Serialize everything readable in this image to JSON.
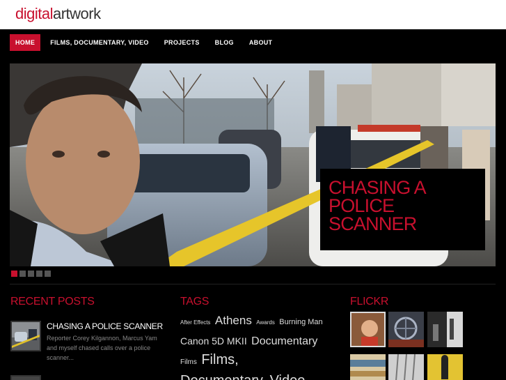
{
  "header": {
    "logo_part1": "digital",
    "logo_part2": "artwork"
  },
  "nav": {
    "items": [
      "HOME",
      "FILMS, DOCUMENTARY, VIDEO",
      "PROJECTS",
      "BLOG",
      "ABOUT"
    ],
    "active": "HOME"
  },
  "slider": {
    "caption_line1": "CHASING A",
    "caption_line2": "POLICE",
    "caption_line3": "SCANNER",
    "slide_count": 5,
    "active_index": 0
  },
  "recent_posts": {
    "title": "RECENT POSTS",
    "posts": [
      {
        "title": "CHASING A POLICE SCANNER",
        "excerpt": "Reporter Corey Kilgannon, Marcus Yam and myself chased calls over a police scanner..."
      }
    ]
  },
  "tags": {
    "title": "TAGS",
    "items": [
      "After Effects",
      "Athens",
      "Awards",
      "Burning Man",
      "Canon 5D MKII",
      "Documentary",
      "Films",
      "Films, Documentary, Video"
    ]
  },
  "flickr": {
    "title": "FLICKR"
  },
  "colors": {
    "accent": "#c8102e",
    "background": "#000000",
    "header_bg": "#ffffff"
  }
}
